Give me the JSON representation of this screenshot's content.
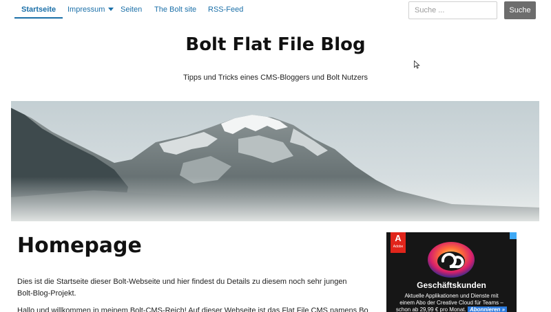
{
  "nav": {
    "items": [
      {
        "label": "Startseite",
        "active": true
      },
      {
        "label": "Impressum",
        "dropdown": true
      },
      {
        "label": "Seiten"
      },
      {
        "label": "The Bolt site"
      },
      {
        "label": "RSS-Feed"
      }
    ],
    "search": {
      "placeholder": "Suche ...",
      "button_label": "Suche"
    }
  },
  "header": {
    "title": "Bolt Flat File Blog",
    "tagline": "Tipps und Tricks eines CMS-Bloggers und Bolt Nutzers"
  },
  "banner": {
    "icon": "mountain-banner-image"
  },
  "main": {
    "heading": "Homepage",
    "paragraphs": [
      "Dies ist die Startseite dieser Bolt-Webseite und hier findest du Details zu diesem noch sehr jungen Bolt-Blog-Projekt.",
      "Hallo und willkommen in meinem Bolt-CMS-Reich! Auf dieser Webseite ist das Flat File CMS namens Bolt"
    ]
  },
  "ad": {
    "brand": "Adobe",
    "brand_glyph": "A",
    "headline": "Geschäftskunden",
    "line1": "Aktuelle Applikationen und Dienste mit",
    "line2": "einem Abo der Creative Cloud für Teams –",
    "line3": "schon ab 29,99 € pro Monat.",
    "cta": "Abonnieren »",
    "accent": "#e1251b"
  },
  "colors": {
    "link": "#1a6fa8",
    "search_button": "#6d6d6d"
  }
}
